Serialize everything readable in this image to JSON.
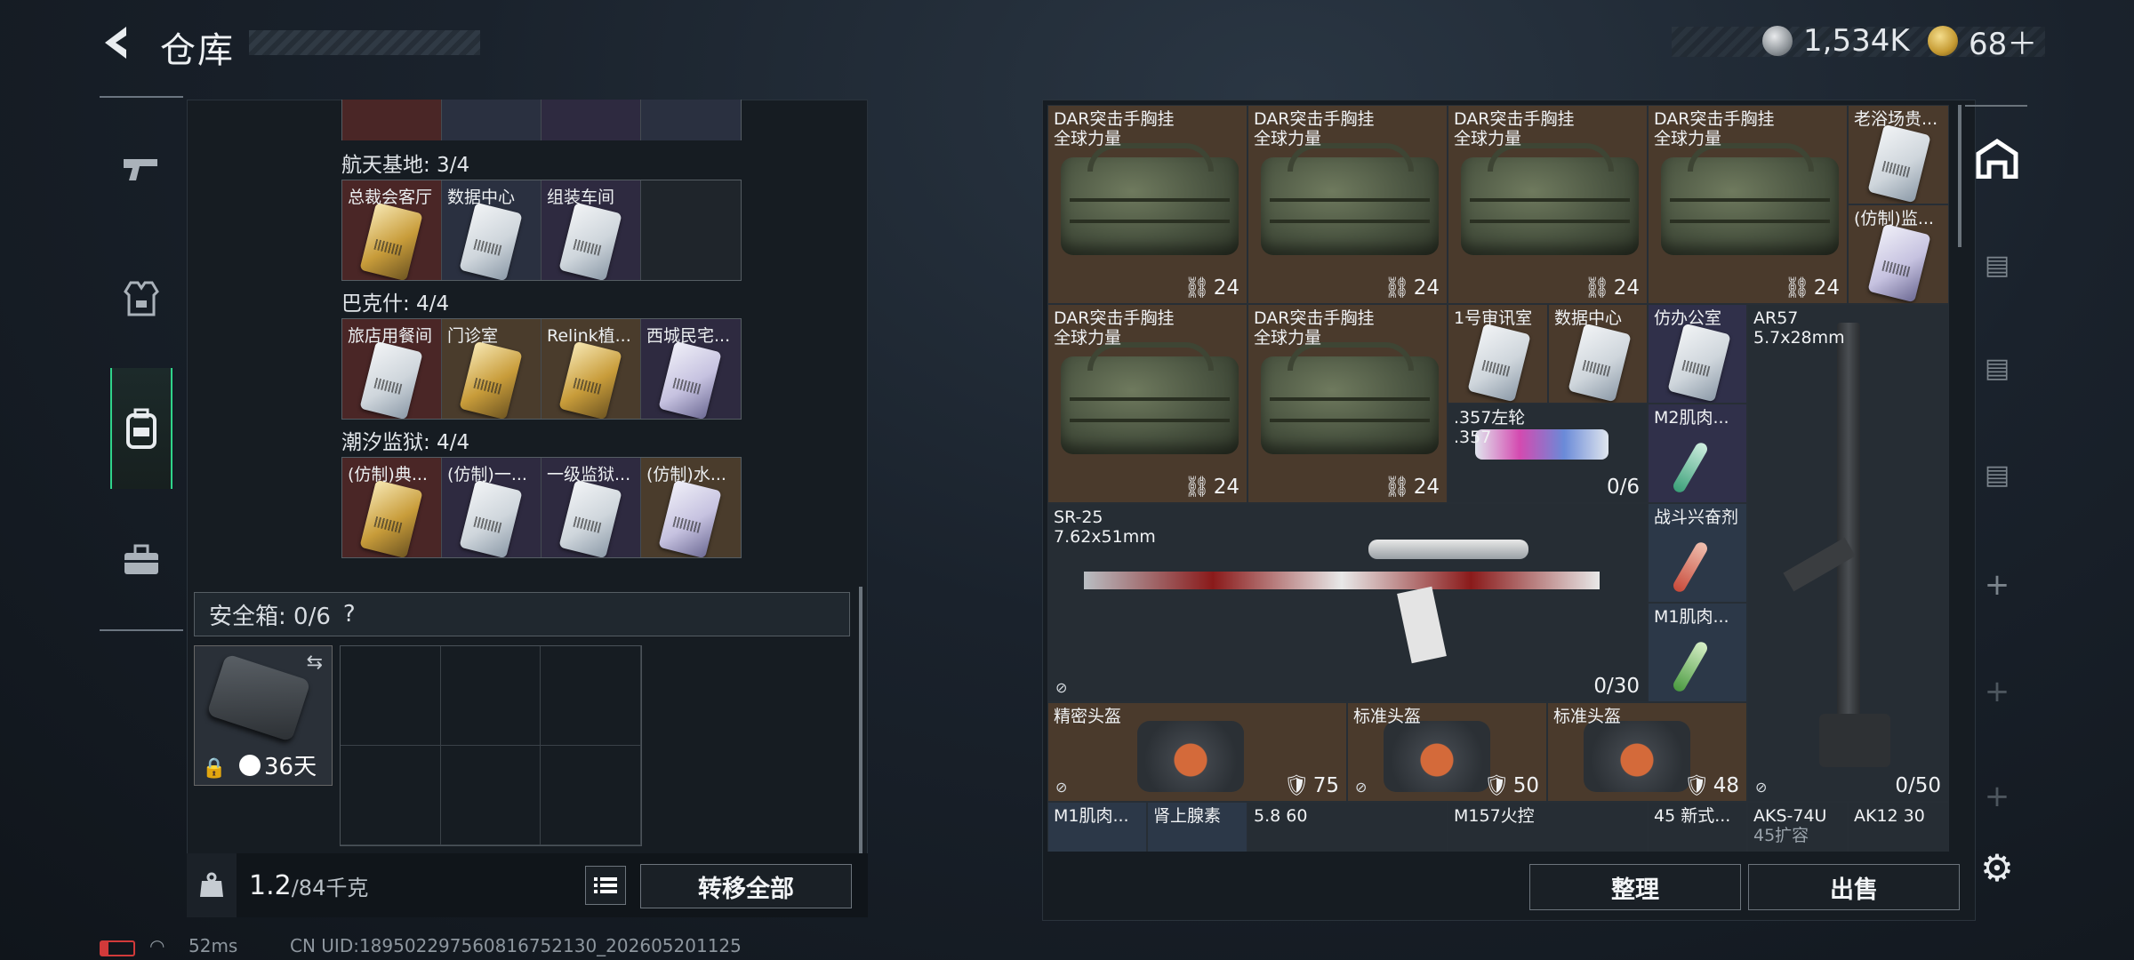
{
  "header": {
    "title": "仓库",
    "silver_amount": "1,534K",
    "gold_amount": "68＋"
  },
  "nav": [
    {
      "icon": "pistol-icon"
    },
    {
      "icon": "armor-vest-icon"
    },
    {
      "icon": "backpack-icon"
    },
    {
      "icon": "toolbox-icon"
    }
  ],
  "left": {
    "sections": [
      {
        "title": "航天基地: 3/4",
        "items": [
          {
            "label": "总裁会客厅",
            "color": "c-red",
            "card": "gold"
          },
          {
            "label": "数据中心",
            "color": "c-blue",
            "card": ""
          },
          {
            "label": "组装车间",
            "color": "c-purp",
            "card": ""
          },
          {
            "label": "",
            "color": "c-empty",
            "card": "none"
          }
        ]
      },
      {
        "title": "巴克什: 4/4",
        "items": [
          {
            "label": "旅店用餐间",
            "color": "c-red",
            "card": ""
          },
          {
            "label": "门诊室",
            "color": "c-gold",
            "card": "gold"
          },
          {
            "label": "Relink植...",
            "color": "c-gold",
            "card": "gold"
          },
          {
            "label": "西城民宅...",
            "color": "c-purp",
            "card": "purple"
          }
        ]
      },
      {
        "title": "潮汐监狱: 4/4",
        "items": [
          {
            "label": "(仿制)典...",
            "color": "c-red",
            "card": "gold"
          },
          {
            "label": "(仿制)一...",
            "color": "c-purp",
            "card": ""
          },
          {
            "label": "一级监狱...",
            "color": "c-purp",
            "card": ""
          },
          {
            "label": "(仿制)水...",
            "color": "c-gold",
            "card": "purple"
          }
        ]
      }
    ],
    "safe_title": "安全箱: 0/6",
    "safe_help": "?",
    "safe_days": "36天",
    "weight_value": "1.2",
    "weight_total": "/84千克",
    "transfer_all": "转移全部"
  },
  "right": {
    "bag_name_1": "DAR突击手胸挂",
    "bag_name_2": "全球力量",
    "bag_count": "24",
    "small": {
      "lao": "老浴场贵...",
      "fangzhi_jian": "(仿制)监...",
      "shenxun": "1号审讯室",
      "shuju": "数据中心",
      "fangban": "仿办公室",
      "ar57_1": "AR57",
      "ar57_2": "5.7x28mm",
      "revolver": ".357左轮",
      "revolver_sub": ".357",
      "revolver_cnt": "0/6",
      "m2": "M2肌肉...",
      "sr25_1": "SR-25",
      "sr25_2": "7.62x51mm",
      "sr25_cnt": "0/30",
      "zhandou": "战斗兴奋剂",
      "m1": "M1肌肉...",
      "ar57_cnt": "0/50",
      "helmet_1": "精密头盔",
      "helmet_1_cnt": "75",
      "helmet_2": "标准头盔",
      "helmet_2_cnt": "50",
      "helmet_3": "标准头盔",
      "helmet_3_cnt": "48"
    },
    "row_bottom": [
      "M1肌肉...",
      "肾上腺素",
      "5.8 60",
      "M157火控",
      "45 新式...",
      "AKS-74U",
      "AK12 30"
    ],
    "row_bottom_sub": "45扩容",
    "sort_btn": "整理",
    "sell_btn": "出售"
  },
  "status": {
    "ping": "52ms",
    "uid": "CN UID:189502297560816752130_202605201125"
  }
}
